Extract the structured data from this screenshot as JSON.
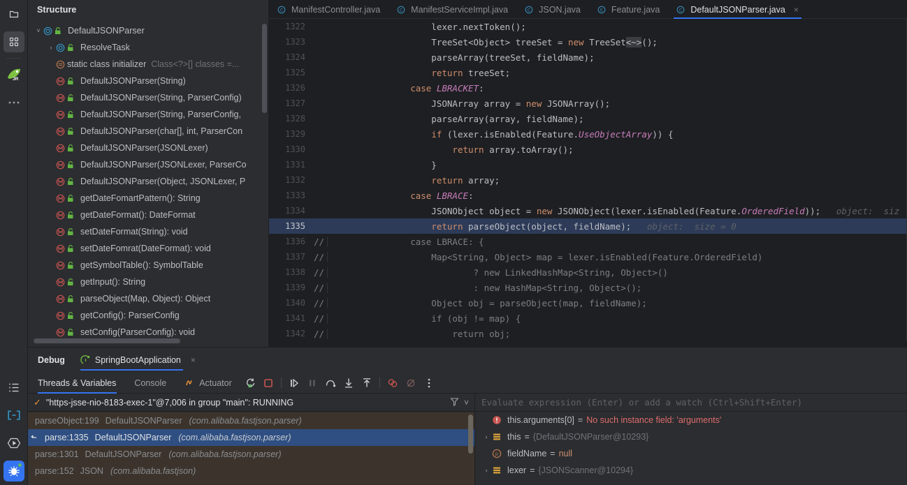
{
  "rail": {
    "top_icons": [
      {
        "name": "project-folder-icon",
        "label": "Project"
      },
      {
        "name": "structure-icon",
        "label": "Structure",
        "active": true
      },
      {
        "name": "jetbrains-runtime-icon",
        "label": "JR"
      },
      {
        "name": "more-tool-windows-icon",
        "label": "..."
      }
    ],
    "bottom_icons": [
      {
        "name": "todo-list-icon",
        "label": "TODO"
      },
      {
        "name": "terminal-icon",
        "label": "Terminal"
      },
      {
        "name": "run-icon",
        "label": "Run"
      },
      {
        "name": "debug-icon",
        "label": "Debug",
        "active": true
      }
    ]
  },
  "structure": {
    "title": "Structure",
    "items": [
      {
        "indent": 0,
        "arrow": "v",
        "kind": "class",
        "label": "DefaultJSONParser",
        "detail": ""
      },
      {
        "indent": 1,
        "arrow": ">",
        "kind": "class",
        "label": "ResolveTask",
        "detail": ""
      },
      {
        "indent": 1,
        "arrow": "",
        "kind": "initializer",
        "label": "static class initializer",
        "detail": "Class<?>[] classes =..."
      },
      {
        "indent": 1,
        "arrow": "",
        "kind": "method",
        "label": "DefaultJSONParser(String)",
        "detail": ""
      },
      {
        "indent": 1,
        "arrow": "",
        "kind": "method",
        "label": "DefaultJSONParser(String, ParserConfig)",
        "detail": ""
      },
      {
        "indent": 1,
        "arrow": "",
        "kind": "method",
        "label": "DefaultJSONParser(String, ParserConfig,",
        "detail": ""
      },
      {
        "indent": 1,
        "arrow": "",
        "kind": "method",
        "label": "DefaultJSONParser(char[], int, ParserCon",
        "detail": ""
      },
      {
        "indent": 1,
        "arrow": "",
        "kind": "method",
        "label": "DefaultJSONParser(JSONLexer)",
        "detail": ""
      },
      {
        "indent": 1,
        "arrow": "",
        "kind": "method",
        "label": "DefaultJSONParser(JSONLexer, ParserCo",
        "detail": ""
      },
      {
        "indent": 1,
        "arrow": "",
        "kind": "method",
        "label": "DefaultJSONParser(Object, JSONLexer, P",
        "detail": ""
      },
      {
        "indent": 1,
        "arrow": "",
        "kind": "method",
        "label": "getDateFomartPattern(): String",
        "detail": ""
      },
      {
        "indent": 1,
        "arrow": "",
        "kind": "method",
        "label": "getDateFormat(): DateFormat",
        "detail": ""
      },
      {
        "indent": 1,
        "arrow": "",
        "kind": "method",
        "label": "setDateFormat(String): void",
        "detail": ""
      },
      {
        "indent": 1,
        "arrow": "",
        "kind": "method",
        "label": "setDateFomrat(DateFormat): void",
        "detail": ""
      },
      {
        "indent": 1,
        "arrow": "",
        "kind": "method",
        "label": "getSymbolTable(): SymbolTable",
        "detail": ""
      },
      {
        "indent": 1,
        "arrow": "",
        "kind": "method",
        "label": "getInput(): String",
        "detail": ""
      },
      {
        "indent": 1,
        "arrow": "",
        "kind": "method",
        "label": "parseObject(Map, Object): Object",
        "detail": ""
      },
      {
        "indent": 1,
        "arrow": "",
        "kind": "method",
        "label": "getConfig(): ParserConfig",
        "detail": ""
      },
      {
        "indent": 1,
        "arrow": "",
        "kind": "method",
        "label": "setConfig(ParserConfig): void",
        "detail": ""
      }
    ]
  },
  "editor": {
    "tabs": [
      {
        "label": "ManifestController.java",
        "badge": "C",
        "active": false,
        "closable": false
      },
      {
        "label": "ManifestServiceImpl.java",
        "badge": "C",
        "active": false,
        "closable": false
      },
      {
        "label": "JSON.java",
        "badge": "C",
        "active": false,
        "closable": false
      },
      {
        "label": "Feature.java",
        "badge": "E",
        "active": false,
        "closable": false
      },
      {
        "label": "DefaultJSONParser.java",
        "badge": "C",
        "active": true,
        "closable": true
      }
    ],
    "close_glyph": "×",
    "current_line": 1335,
    "lines": [
      {
        "n": 1322,
        "comment": false,
        "exec": false,
        "tokens": [
          {
            "t": "            lexer.nextToken();"
          }
        ]
      },
      {
        "n": 1323,
        "comment": false,
        "exec": false,
        "tokens": [
          {
            "t": "            TreeSet<Object> treeSet = "
          },
          {
            "t": "new",
            "c": "k"
          },
          {
            "t": " TreeSet"
          },
          {
            "t": "<~>",
            "c": "gen-hl"
          },
          {
            "t": "();"
          }
        ]
      },
      {
        "n": 1324,
        "comment": false,
        "exec": false,
        "tokens": [
          {
            "t": "            parseArray(treeSet, fieldName);"
          }
        ]
      },
      {
        "n": 1325,
        "comment": false,
        "exec": false,
        "tokens": [
          {
            "t": "            "
          },
          {
            "t": "return",
            "c": "k"
          },
          {
            "t": " treeSet;"
          }
        ]
      },
      {
        "n": 1326,
        "comment": false,
        "exec": false,
        "tokens": [
          {
            "t": "        "
          },
          {
            "t": "case",
            "c": "k"
          },
          {
            "t": " "
          },
          {
            "t": "LBRACKET",
            "c": "cst"
          },
          {
            "t": ":"
          }
        ]
      },
      {
        "n": 1327,
        "comment": false,
        "exec": false,
        "tokens": [
          {
            "t": "            JSONArray array = "
          },
          {
            "t": "new",
            "c": "k"
          },
          {
            "t": " JSONArray();"
          }
        ]
      },
      {
        "n": 1328,
        "comment": false,
        "exec": false,
        "tokens": [
          {
            "t": "            parseArray(array, fieldName);"
          }
        ]
      },
      {
        "n": 1329,
        "comment": false,
        "exec": false,
        "tokens": [
          {
            "t": "            "
          },
          {
            "t": "if",
            "c": "k"
          },
          {
            "t": " (lexer.isEnabled(Feature."
          },
          {
            "t": "UseObjectArray",
            "c": "cst"
          },
          {
            "t": ")) {"
          }
        ]
      },
      {
        "n": 1330,
        "comment": false,
        "exec": false,
        "tokens": [
          {
            "t": "                "
          },
          {
            "t": "return",
            "c": "k"
          },
          {
            "t": " array.toArray();"
          }
        ]
      },
      {
        "n": 1331,
        "comment": false,
        "exec": false,
        "tokens": [
          {
            "t": "            }"
          }
        ]
      },
      {
        "n": 1332,
        "comment": false,
        "exec": false,
        "tokens": [
          {
            "t": "            "
          },
          {
            "t": "return",
            "c": "k"
          },
          {
            "t": " array;"
          }
        ]
      },
      {
        "n": 1333,
        "comment": false,
        "exec": false,
        "tokens": [
          {
            "t": "        "
          },
          {
            "t": "case",
            "c": "k"
          },
          {
            "t": " "
          },
          {
            "t": "LBRACE",
            "c": "cst"
          },
          {
            "t": ":"
          }
        ]
      },
      {
        "n": 1334,
        "comment": false,
        "exec": false,
        "tokens": [
          {
            "t": "            JSONObject object = "
          },
          {
            "t": "new",
            "c": "k"
          },
          {
            "t": " JSONObject(lexer.isEnabled(Feature."
          },
          {
            "t": "OrderedField",
            "c": "cst"
          },
          {
            "t": "));"
          },
          {
            "t": "   object:  siz",
            "c": "hint"
          }
        ]
      },
      {
        "n": 1335,
        "comment": false,
        "exec": true,
        "tokens": [
          {
            "t": "            "
          },
          {
            "t": "return",
            "c": "k"
          },
          {
            "t": " parseObject(object, fieldName);"
          },
          {
            "t": "   object:  size = 0",
            "c": "hint"
          }
        ]
      },
      {
        "n": 1336,
        "comment": true,
        "exec": false,
        "tokens": [
          {
            "t": "        case LBRACE: {",
            "c": "cmt"
          }
        ]
      },
      {
        "n": 1337,
        "comment": true,
        "exec": false,
        "tokens": [
          {
            "t": "            Map<String, Object> map = lexer.isEnabled(Feature.OrderedField)",
            "c": "cmt"
          }
        ]
      },
      {
        "n": 1338,
        "comment": true,
        "exec": false,
        "tokens": [
          {
            "t": "                    ? new LinkedHashMap<String, Object>()",
            "c": "cmt"
          }
        ]
      },
      {
        "n": 1339,
        "comment": true,
        "exec": false,
        "tokens": [
          {
            "t": "                    : new HashMap<String, Object>();",
            "c": "cmt"
          }
        ]
      },
      {
        "n": 1340,
        "comment": true,
        "exec": false,
        "tokens": [
          {
            "t": "            Object obj = parseObject(map, fieldName);",
            "c": "cmt"
          }
        ]
      },
      {
        "n": 1341,
        "comment": true,
        "exec": false,
        "tokens": [
          {
            "t": "            if (obj != map) {",
            "c": "cmt"
          }
        ]
      },
      {
        "n": 1342,
        "comment": true,
        "exec": false,
        "tokens": [
          {
            "t": "                return obj;",
            "c": "cmt"
          }
        ]
      }
    ],
    "comment_marker": "//"
  },
  "debug": {
    "panel_title": "Debug",
    "config_name": "SpringBootApplication",
    "config_close": "×",
    "tabs": [
      {
        "label": "Threads & Variables",
        "active": true,
        "icon": ""
      },
      {
        "label": "Console",
        "active": false,
        "icon": ""
      },
      {
        "label": "Actuator",
        "active": false,
        "icon": "actuator-icon"
      }
    ],
    "toolbar_icons": [
      {
        "name": "rerun-debug-icon",
        "title": "Rerun"
      },
      {
        "name": "stop-icon",
        "title": "Stop"
      },
      {
        "name": "resume-program-icon",
        "title": "Resume Program"
      },
      {
        "name": "pause-program-icon",
        "title": "Pause Program",
        "disabled": true
      },
      {
        "name": "step-over-icon",
        "title": "Step Over"
      },
      {
        "name": "step-into-icon",
        "title": "Step Into"
      },
      {
        "name": "step-out-icon",
        "title": "Step Out"
      },
      {
        "name": "view-breakpoints-icon",
        "title": "View Breakpoints"
      },
      {
        "name": "mute-breakpoints-icon",
        "title": "Mute Breakpoints"
      },
      {
        "name": "more-options-icon",
        "title": "More"
      }
    ],
    "thread": {
      "status_glyph": "✓",
      "text": "\"https-jsse-nio-8183-exec-1\"@7,006 in group \"main\": RUNNING",
      "filter_icon": "filter-icon",
      "chevron": "˅"
    },
    "frames": [
      {
        "method": "parseObject:199",
        "cls": "DefaultJSONParser",
        "pkg": "(com.alibaba.fastjson.parser)",
        "selected": false
      },
      {
        "method": "parse:1335",
        "cls": "DefaultJSONParser",
        "pkg": "(com.alibaba.fastjson.parser)",
        "selected": true
      },
      {
        "method": "parse:1301",
        "cls": "DefaultJSONParser",
        "pkg": "(com.alibaba.fastjson.parser)",
        "selected": false
      },
      {
        "method": "parse:152",
        "cls": "JSON",
        "pkg": "(com.alibaba.fastjson)",
        "selected": false
      }
    ],
    "evaluate_placeholder": "Evaluate expression (Enter) or add a watch (Ctrl+Shift+Enter)",
    "variables": [
      {
        "arrow": "",
        "icon": "error-icon",
        "name": "this.arguments[0]",
        "eq": "=",
        "value": "No such instance field: 'arguments'",
        "value_class": "verr"
      },
      {
        "arrow": ">",
        "icon": "object-icon",
        "name": "this",
        "eq": "=",
        "value": "{DefaultJSONParser@10293}",
        "value_class": "vobj"
      },
      {
        "arrow": "",
        "icon": "param-icon",
        "name": "fieldName",
        "eq": "=",
        "value": "null",
        "value_class": "vnull"
      },
      {
        "arrow": ">",
        "icon": "object-icon",
        "name": "lexer",
        "eq": "=",
        "value": "{JSONScanner@10294}",
        "value_class": "vobj"
      }
    ]
  },
  "colors": {
    "accent_blue": "#3574f0",
    "exec_line": "#2d3b58",
    "frames_bg": "#3c342c",
    "selected_frame": "#2f4f82",
    "keyword": "#cf8e6d",
    "constant": "#c77dbb",
    "comment": "#7a7e85",
    "error_red": "#e06c6c"
  }
}
